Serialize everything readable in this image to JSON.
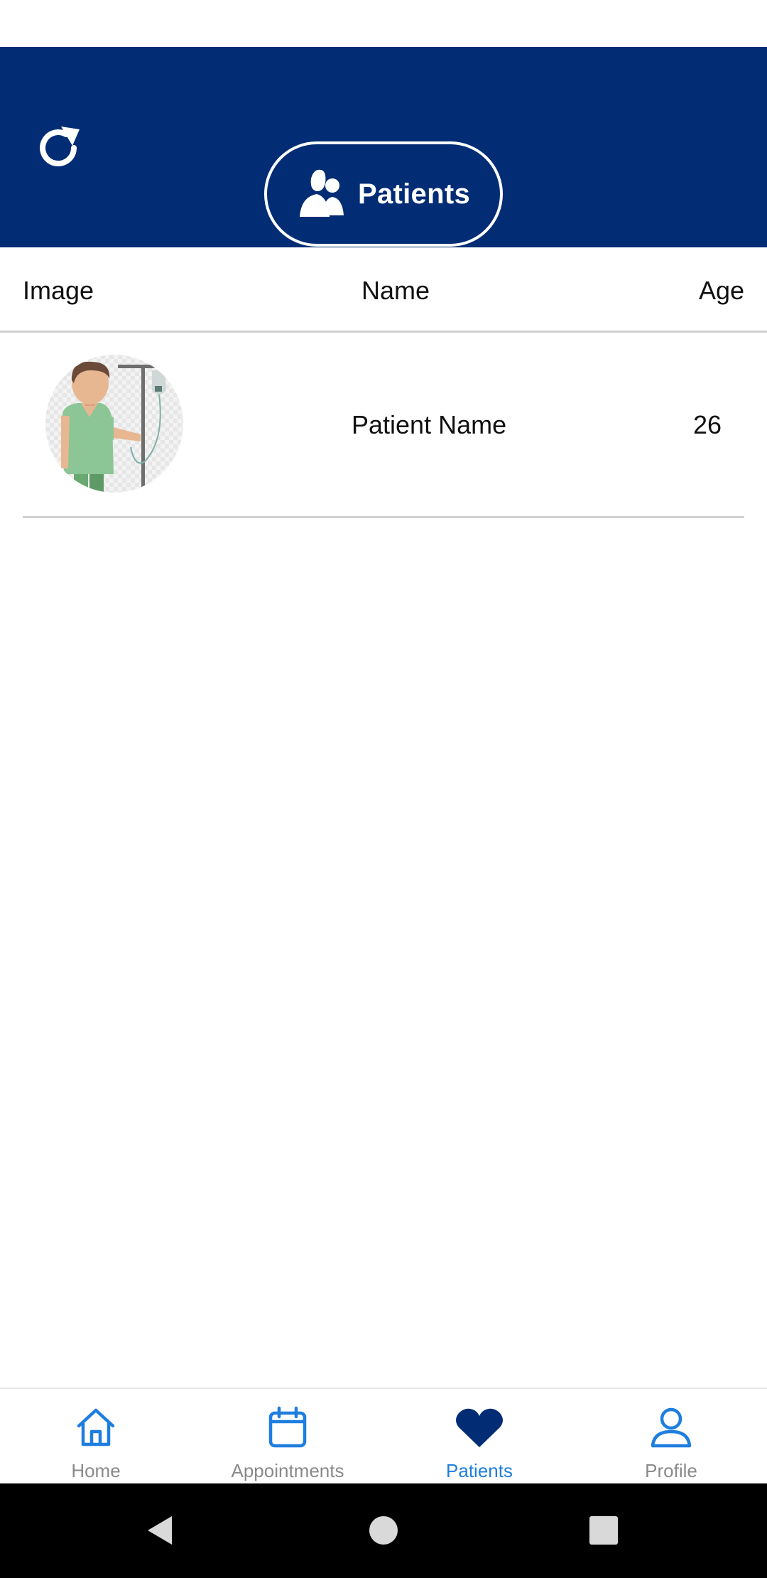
{
  "header": {
    "title": "Patients",
    "refresh_icon": "refresh-icon",
    "title_icon": "patients-group-icon",
    "color": "#022d75"
  },
  "table": {
    "columns": [
      "Image",
      "Name",
      "Age"
    ],
    "rows": [
      {
        "image": "patient-avatar",
        "name": "Patient Name",
        "age": "26"
      }
    ]
  },
  "bottom_nav": {
    "items": [
      {
        "label": "Home",
        "icon": "home-icon",
        "active": false
      },
      {
        "label": "Appointments",
        "icon": "calendar-icon",
        "active": false
      },
      {
        "label": "Patients",
        "icon": "heart-icon",
        "active": true
      },
      {
        "label": "Profile",
        "icon": "user-icon",
        "active": false
      }
    ],
    "accent_color": "#1e7ee0"
  },
  "system_nav": {
    "buttons": [
      "back-icon",
      "home-circle-icon",
      "recents-icon"
    ]
  }
}
